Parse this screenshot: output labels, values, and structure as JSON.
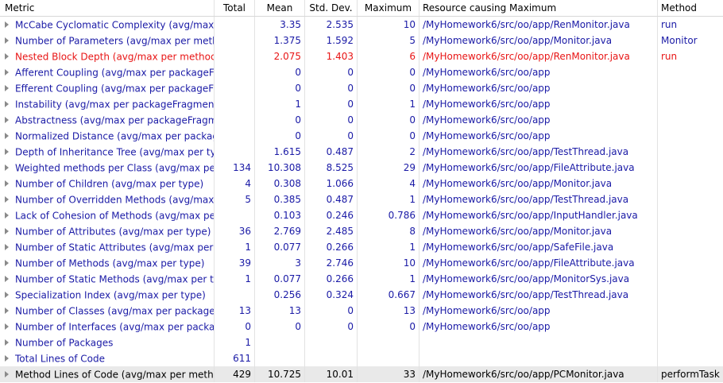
{
  "columns": {
    "metric": "Metric",
    "total": "Total",
    "mean": "Mean",
    "std": "Std. Dev.",
    "max": "Maximum",
    "resource": "Resource causing Maximum",
    "method": "Method"
  },
  "rows": [
    {
      "metric": "McCabe Cyclomatic Complexity (avg/max",
      "total": "",
      "mean": "3.35",
      "std": "2.535",
      "max": "10",
      "resource": "/MyHomework6/src/oo/app/RenMonitor.java",
      "method": "run"
    },
    {
      "metric": "Number of Parameters (avg/max per meth",
      "total": "",
      "mean": "1.375",
      "std": "1.592",
      "max": "5",
      "resource": "/MyHomework6/src/oo/app/Monitor.java",
      "method": "Monitor"
    },
    {
      "metric": "Nested Block Depth (avg/max per methoc",
      "total": "",
      "mean": "2.075",
      "std": "1.403",
      "max": "6",
      "resource": "/MyHomework6/src/oo/app/RenMonitor.java",
      "method": "run"
    },
    {
      "metric": "Afferent Coupling (avg/max per packageF",
      "total": "",
      "mean": "0",
      "std": "0",
      "max": "0",
      "resource": "/MyHomework6/src/oo/app",
      "method": ""
    },
    {
      "metric": "Efferent Coupling (avg/max per packageFr",
      "total": "",
      "mean": "0",
      "std": "0",
      "max": "0",
      "resource": "/MyHomework6/src/oo/app",
      "method": ""
    },
    {
      "metric": "Instability (avg/max per packageFragment",
      "total": "",
      "mean": "1",
      "std": "0",
      "max": "1",
      "resource": "/MyHomework6/src/oo/app",
      "method": ""
    },
    {
      "metric": "Abstractness (avg/max per packageFragm",
      "total": "",
      "mean": "0",
      "std": "0",
      "max": "0",
      "resource": "/MyHomework6/src/oo/app",
      "method": ""
    },
    {
      "metric": "Normalized Distance (avg/max per packag",
      "total": "",
      "mean": "0",
      "std": "0",
      "max": "0",
      "resource": "/MyHomework6/src/oo/app",
      "method": ""
    },
    {
      "metric": "Depth of Inheritance Tree (avg/max per ty",
      "total": "",
      "mean": "1.615",
      "std": "0.487",
      "max": "2",
      "resource": "/MyHomework6/src/oo/app/TestThread.java",
      "method": ""
    },
    {
      "metric": "Weighted methods per Class (avg/max pe",
      "total": "134",
      "mean": "10.308",
      "std": "8.525",
      "max": "29",
      "resource": "/MyHomework6/src/oo/app/FileAttribute.java",
      "method": ""
    },
    {
      "metric": "Number of Children (avg/max per type)",
      "total": "4",
      "mean": "0.308",
      "std": "1.066",
      "max": "4",
      "resource": "/MyHomework6/src/oo/app/Monitor.java",
      "method": ""
    },
    {
      "metric": "Number of Overridden Methods (avg/max",
      "total": "5",
      "mean": "0.385",
      "std": "0.487",
      "max": "1",
      "resource": "/MyHomework6/src/oo/app/TestThread.java",
      "method": ""
    },
    {
      "metric": "Lack of Cohesion of Methods (avg/max pe",
      "total": "",
      "mean": "0.103",
      "std": "0.246",
      "max": "0.786",
      "resource": "/MyHomework6/src/oo/app/InputHandler.java",
      "method": ""
    },
    {
      "metric": "Number of Attributes (avg/max per type)",
      "total": "36",
      "mean": "2.769",
      "std": "2.485",
      "max": "8",
      "resource": "/MyHomework6/src/oo/app/Monitor.java",
      "method": ""
    },
    {
      "metric": "Number of Static Attributes (avg/max per",
      "total": "1",
      "mean": "0.077",
      "std": "0.266",
      "max": "1",
      "resource": "/MyHomework6/src/oo/app/SafeFile.java",
      "method": ""
    },
    {
      "metric": "Number of Methods (avg/max per type)",
      "total": "39",
      "mean": "3",
      "std": "2.746",
      "max": "10",
      "resource": "/MyHomework6/src/oo/app/FileAttribute.java",
      "method": ""
    },
    {
      "metric": "Number of Static Methods (avg/max per t",
      "total": "1",
      "mean": "0.077",
      "std": "0.266",
      "max": "1",
      "resource": "/MyHomework6/src/oo/app/MonitorSys.java",
      "method": ""
    },
    {
      "metric": "Specialization Index (avg/max per type)",
      "total": "",
      "mean": "0.256",
      "std": "0.324",
      "max": "0.667",
      "resource": "/MyHomework6/src/oo/app/TestThread.java",
      "method": ""
    },
    {
      "metric": "Number of Classes (avg/max per package",
      "total": "13",
      "mean": "13",
      "std": "0",
      "max": "13",
      "resource": "/MyHomework6/src/oo/app",
      "method": ""
    },
    {
      "metric": "Number of Interfaces (avg/max per packa",
      "total": "0",
      "mean": "0",
      "std": "0",
      "max": "0",
      "resource": "/MyHomework6/src/oo/app",
      "method": ""
    },
    {
      "metric": "Number of Packages",
      "total": "1",
      "mean": "",
      "std": "",
      "max": "",
      "resource": "",
      "method": ""
    },
    {
      "metric": "Total Lines of Code",
      "total": "611",
      "mean": "",
      "std": "",
      "max": "",
      "resource": "",
      "method": ""
    },
    {
      "metric": "Method Lines of Code (avg/max per meth",
      "total": "429",
      "mean": "10.725",
      "std": "10.01",
      "max": "33",
      "resource": "/MyHomework6/src/oo/app/PCMonitor.java",
      "method": "performTask"
    }
  ],
  "colors": {
    "normal_text": "#1a1aa6",
    "error_text": "#e81515",
    "selected_row": "#e9e9e9"
  },
  "error_row_index": 2,
  "selected_row_index": 22
}
